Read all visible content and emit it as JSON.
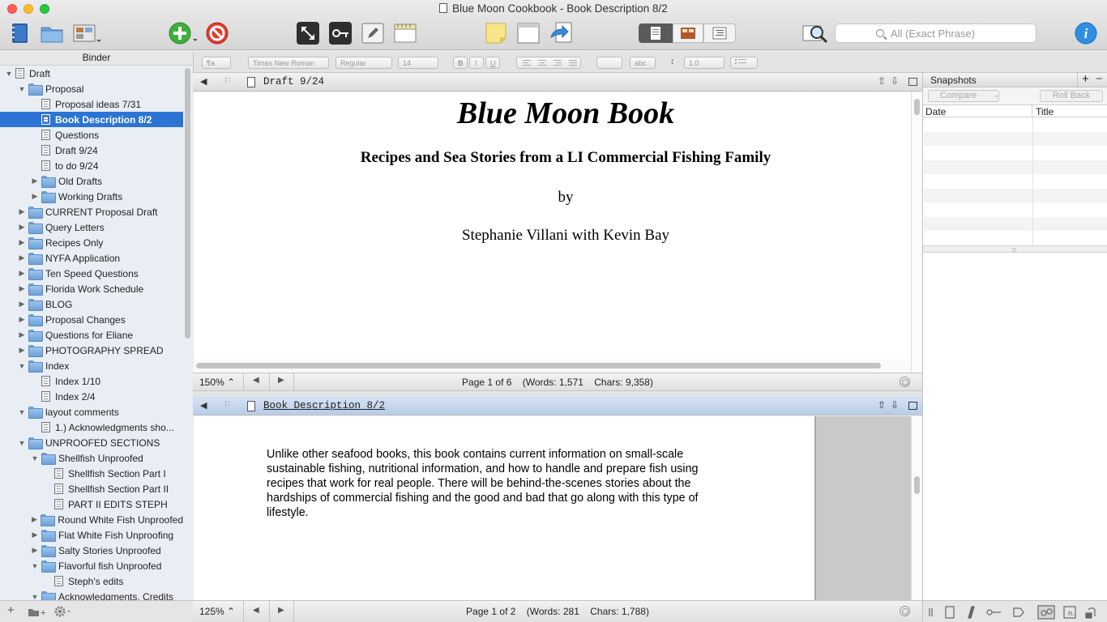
{
  "window": {
    "title": "Blue Moon Cookbook - Book Description 8/2"
  },
  "search": {
    "placeholder": "All (Exact Phrase)"
  },
  "binder": {
    "header": "Binder",
    "items": [
      {
        "label": "Draft",
        "level": 0,
        "type": "doc",
        "expanded": true
      },
      {
        "label": "Proposal",
        "level": 1,
        "type": "folder",
        "expanded": true
      },
      {
        "label": "Proposal ideas 7/31",
        "level": 2,
        "type": "doc"
      },
      {
        "label": "Book Description 8/2",
        "level": 2,
        "type": "doc",
        "selected": true
      },
      {
        "label": "Questions",
        "level": 2,
        "type": "doc"
      },
      {
        "label": "Draft 9/24",
        "level": 2,
        "type": "doc"
      },
      {
        "label": "to do 9/24",
        "level": 2,
        "type": "doc"
      },
      {
        "label": "Old Drafts",
        "level": 2,
        "type": "folder",
        "expanded": false
      },
      {
        "label": "Working Drafts",
        "level": 2,
        "type": "folder",
        "expanded": false
      },
      {
        "label": "CURRENT Proposal Draft",
        "level": 1,
        "type": "folder",
        "expanded": false
      },
      {
        "label": "Query Letters",
        "level": 1,
        "type": "folder",
        "expanded": false
      },
      {
        "label": "Recipes Only",
        "level": 1,
        "type": "folder",
        "expanded": false
      },
      {
        "label": "NYFA Application",
        "level": 1,
        "type": "folder",
        "expanded": false
      },
      {
        "label": "Ten Speed Questions",
        "level": 1,
        "type": "folder",
        "expanded": false
      },
      {
        "label": "Florida Work Schedule",
        "level": 1,
        "type": "folder",
        "expanded": false
      },
      {
        "label": "BLOG",
        "level": 1,
        "type": "folder",
        "expanded": false
      },
      {
        "label": "Proposal Changes",
        "level": 1,
        "type": "folder",
        "expanded": false
      },
      {
        "label": "Questions for Eliane",
        "level": 1,
        "type": "folder",
        "expanded": false
      },
      {
        "label": "PHOTOGRAPHY SPREAD",
        "level": 1,
        "type": "folder",
        "expanded": false
      },
      {
        "label": "Index",
        "level": 1,
        "type": "folder",
        "expanded": true
      },
      {
        "label": "Index 1/10",
        "level": 2,
        "type": "doc"
      },
      {
        "label": "Index 2/4",
        "level": 2,
        "type": "doc"
      },
      {
        "label": "layout comments",
        "level": 1,
        "type": "folder",
        "expanded": true
      },
      {
        "label": "1.) Acknowledgments sho...",
        "level": 2,
        "type": "doc"
      },
      {
        "label": "UNPROOFED SECTIONS",
        "level": 1,
        "type": "folder",
        "expanded": true
      },
      {
        "label": "Shellfish Unproofed",
        "level": 2,
        "type": "folder",
        "expanded": true
      },
      {
        "label": "Shellfish Section Part I",
        "level": 3,
        "type": "doc"
      },
      {
        "label": "Shellfish Section Part II",
        "level": 3,
        "type": "doc"
      },
      {
        "label": "PART II EDITS STEPH",
        "level": 3,
        "type": "doc"
      },
      {
        "label": "Round White Fish Unproofed",
        "level": 2,
        "type": "folder",
        "expanded": false
      },
      {
        "label": "Flat White Fish Unproofing",
        "level": 2,
        "type": "folder",
        "expanded": false
      },
      {
        "label": "Salty Stories Unproofed",
        "level": 2,
        "type": "folder",
        "expanded": false
      },
      {
        "label": "Flavorful fish Unproofed",
        "level": 2,
        "type": "folder",
        "expanded": true
      },
      {
        "label": "Steph's edits",
        "level": 3,
        "type": "doc"
      },
      {
        "label": "Acknowledgments, Credits",
        "level": 2,
        "type": "folder",
        "expanded": true
      }
    ]
  },
  "format_bar": {
    "style": "¶a",
    "font": "Times New Roman",
    "weight": "Regular",
    "size": "14",
    "bold": "B",
    "italic": "I",
    "underline": "U",
    "highlight": "abc",
    "line_spacing": "1.0"
  },
  "editor_top": {
    "header_title": "Draft 9/24",
    "title": "Blue Moon Book",
    "subtitle": "Recipes and Sea Stories from a LI Commercial Fishing Family",
    "by": "by",
    "authors": "Stephanie Villani with Kevin Bay",
    "zoom": "150%",
    "page": "Page 1 of 6",
    "words": "(Words: 1,571",
    "chars": "Chars: 9,358)"
  },
  "editor_bottom": {
    "header_title": "Book Description 8/2",
    "body": "Unlike other seafood books, this book contains current information on small-scale sustainable fishing, nutritional information, and how to handle and prepare fish using recipes that work for real people.  There will be behind-the-scenes stories about the hardships of commercial fishing and the good and bad that go along with this type of lifestyle.",
    "zoom": "125%",
    "page": "Page 1 of 2",
    "words": "(Words: 281",
    "chars": "Chars: 1,788)"
  },
  "snapshots": {
    "header": "Snapshots",
    "add": "+",
    "remove": "−",
    "compare": "Compare",
    "rollback": "Roll Back",
    "col_date": "Date",
    "col_title": "Title"
  },
  "colors": {
    "selection": "#2b74d4",
    "binder_bg": "#e9eef4",
    "folder": "#6ea0d6"
  }
}
